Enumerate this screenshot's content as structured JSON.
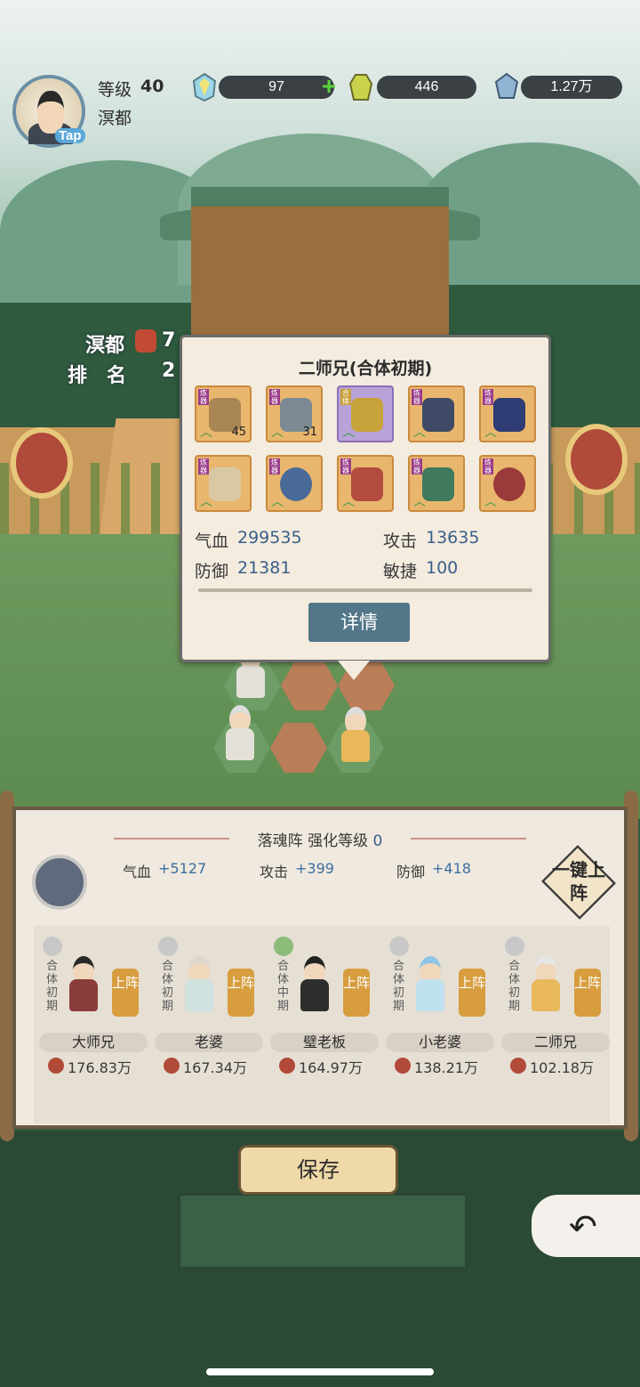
{
  "player": {
    "level_label": "等级",
    "level": "40",
    "name": "溟都",
    "avatar_tag": "Tap"
  },
  "resources": [
    {
      "icon": "spirit-gem-icon",
      "value": "97"
    },
    {
      "icon": "robe-icon",
      "value": "446"
    },
    {
      "icon": "crystal-icon",
      "value": "1.27万"
    }
  ],
  "ranking": {
    "name": "溟都",
    "power_partial": "7",
    "rank_label": "排　名",
    "rank_partial": "2"
  },
  "popup": {
    "title": "二师兄(合体初期)",
    "equipment": [
      {
        "icon": "sword-icon",
        "tag": "炼器",
        "count": "45",
        "rarity": "orange"
      },
      {
        "icon": "cauldron-icon",
        "tag": "炼器",
        "count": "31",
        "rarity": "orange"
      },
      {
        "icon": "armor-icon",
        "tag": "合体",
        "count": "",
        "rarity": "purple"
      },
      {
        "icon": "helmet-icon",
        "tag": "炼器",
        "count": "",
        "rarity": "orange"
      },
      {
        "icon": "bracer-icon",
        "tag": "炼器",
        "count": "",
        "rarity": "orange"
      },
      {
        "icon": "fan-icon",
        "tag": "炼器",
        "count": "",
        "rarity": "orange"
      },
      {
        "icon": "necklace-icon",
        "tag": "炼器",
        "count": "",
        "rarity": "orange"
      },
      {
        "icon": "boots-icon",
        "tag": "炼器",
        "count": "",
        "rarity": "orange"
      },
      {
        "icon": "belt-icon",
        "tag": "炼器",
        "count": "",
        "rarity": "orange"
      },
      {
        "icon": "ring-icon",
        "tag": "炼器",
        "count": "",
        "rarity": "orange"
      }
    ],
    "stats": {
      "hp_label": "气血",
      "hp": "299535",
      "atk_label": "攻击",
      "atk": "13635",
      "def_label": "防御",
      "def": "21381",
      "agi_label": "敏捷",
      "agi": "100"
    },
    "detail_label": "详情"
  },
  "formation": {
    "title": "落魂阵 强化等级",
    "level": "0",
    "hp_label": "气血",
    "hp_bonus": "+5127",
    "atk_label": "攻击",
    "atk_bonus": "+399",
    "def_label": "防御",
    "def_bonus": "+418",
    "onekey_label": "一键上阵"
  },
  "roster": [
    {
      "name": "大师兄",
      "stage": "合体初期",
      "power": "176.83万",
      "btn": "上阵",
      "element": "cloud"
    },
    {
      "name": "老婆",
      "stage": "合体初期",
      "power": "167.34万",
      "btn": "上阵",
      "element": "cloud"
    },
    {
      "name": "璧老板",
      "stage": "合体中期",
      "power": "164.97万",
      "btn": "上阵",
      "element": "leaf"
    },
    {
      "name": "小老婆",
      "stage": "合体初期",
      "power": "138.21万",
      "btn": "上阵",
      "element": "cloud"
    },
    {
      "name": "二师兄",
      "stage": "合体初期",
      "power": "102.18万",
      "btn": "上阵",
      "element": "cloud"
    }
  ],
  "save_label": "保存",
  "colors": {
    "accent_blue": "#3b5f8a",
    "gold": "#d79d3f",
    "panel": "#f0e9df"
  }
}
